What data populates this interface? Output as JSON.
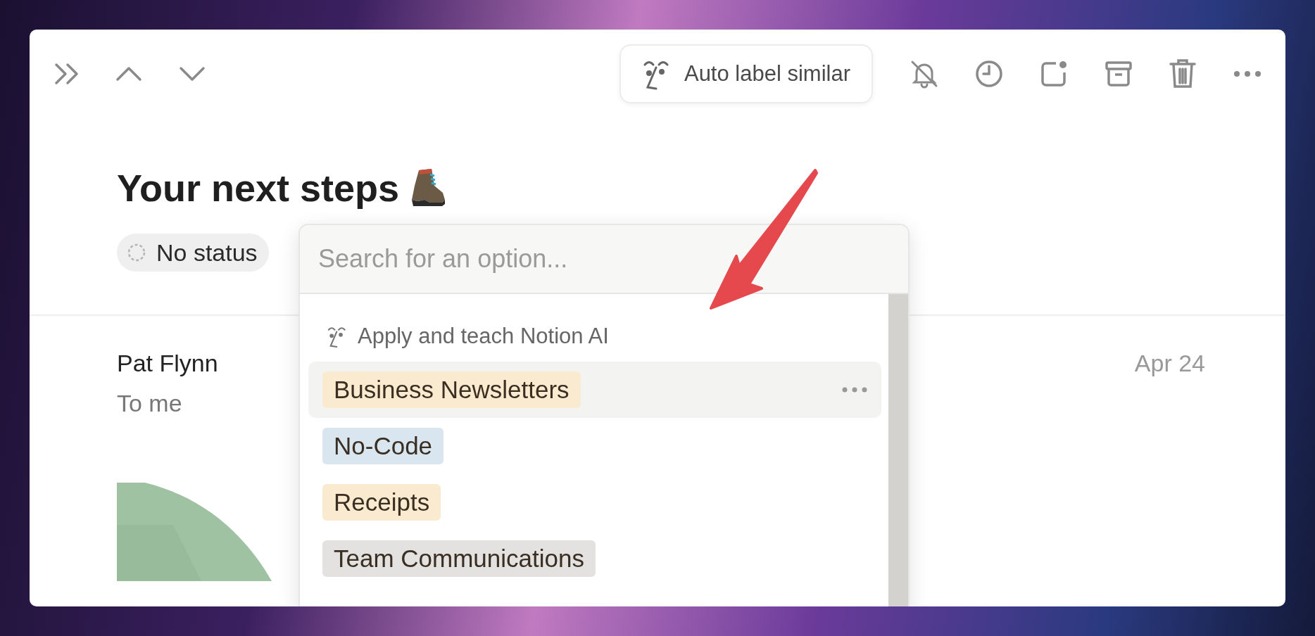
{
  "toolbar": {
    "auto_label_button": "Auto label similar"
  },
  "page": {
    "title": "Your next steps",
    "status": "No status"
  },
  "email": {
    "sender": "Pat Flynn",
    "recipient": "To me",
    "date": "Apr 24"
  },
  "dropdown": {
    "search": {
      "placeholder": "Search for an option..."
    },
    "ai_action": "Apply and teach Notion AI",
    "options": [
      {
        "label": "Business Newsletters",
        "color": "#faebd0",
        "highlighted": true
      },
      {
        "label": "No-Code",
        "color": "#d9e6ef",
        "highlighted": false
      },
      {
        "label": "Receipts",
        "color": "#faebd0",
        "highlighted": false
      },
      {
        "label": "Team Communications",
        "color": "#e3e2e0",
        "highlighted": false
      }
    ]
  }
}
